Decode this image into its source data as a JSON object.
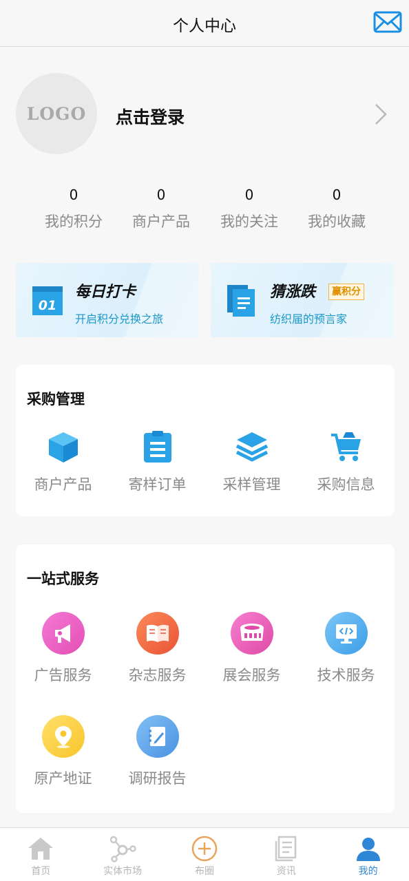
{
  "header": {
    "title": "个人中心",
    "mail_icon": "envelope-icon"
  },
  "profile": {
    "avatar_text": "LOGO",
    "login_label": "点击登录",
    "chevron_icon": "chevron-right-icon"
  },
  "stats": [
    {
      "value": "0",
      "label": "我的积分"
    },
    {
      "value": "0",
      "label": "商户产品"
    },
    {
      "value": "0",
      "label": "我的关注"
    },
    {
      "value": "0",
      "label": "我的收藏"
    }
  ],
  "promos": {
    "checkin": {
      "title": "每日打卡",
      "subtitle": "开启积分兑换之旅",
      "icon_text": "01",
      "icon": "calendar-icon"
    },
    "guess": {
      "title": "猜涨跌",
      "badge": "赢积分",
      "subtitle": "纺织届的预言家",
      "icon": "document-icon"
    }
  },
  "purchase": {
    "title": "采购管理",
    "items": [
      {
        "label": "商户产品",
        "icon": "cube-icon"
      },
      {
        "label": "寄样订单",
        "icon": "clipboard-icon"
      },
      {
        "label": "采样管理",
        "icon": "layers-icon"
      },
      {
        "label": "采购信息",
        "icon": "cart-icon"
      }
    ]
  },
  "service": {
    "title": "一站式服务",
    "items": [
      {
        "label": "广告服务",
        "icon": "megaphone-icon"
      },
      {
        "label": "杂志服务",
        "icon": "book-icon"
      },
      {
        "label": "展会服务",
        "icon": "stadium-icon"
      },
      {
        "label": "技术服务",
        "icon": "monitor-code-icon"
      },
      {
        "label": "原产地证",
        "icon": "location-pin-icon"
      },
      {
        "label": "调研报告",
        "icon": "report-pen-icon"
      }
    ]
  },
  "tabbar": [
    {
      "label": "首页",
      "icon": "home-icon",
      "active": false
    },
    {
      "label": "实体市场",
      "icon": "network-icon",
      "active": false
    },
    {
      "label": "布圈",
      "icon": "plus-circle-icon",
      "active": false
    },
    {
      "label": "资讯",
      "icon": "news-icon",
      "active": false
    },
    {
      "label": "我的",
      "icon": "user-icon",
      "active": true
    }
  ],
  "colors": {
    "accent": "#2f86d6",
    "icon_blue": "#2aa3e6",
    "label_gray": "#8a8a8a"
  }
}
